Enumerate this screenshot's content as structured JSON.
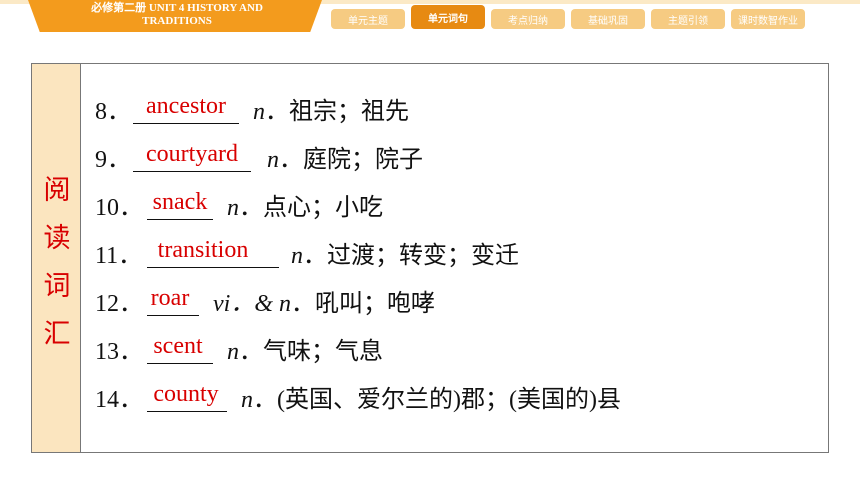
{
  "header": {
    "course_line1": "必修第二册   UNIT 4    HISTORY AND",
    "course_line2": "TRADITIONS",
    "tabs": [
      "单元主题",
      "单元词句",
      "考点归纳",
      "基础巩固",
      "主题引领",
      "课时数智作业"
    ],
    "active_tab": "单元词句"
  },
  "sidebar": {
    "chars": [
      "阅",
      "读",
      "词",
      "汇"
    ]
  },
  "rows": [
    {
      "num": "8．",
      "answer": "ancestor",
      "pos": "n",
      "meaning": "．祖宗；祖先"
    },
    {
      "num": "9．",
      "answer": "courtyard",
      "pos": "n",
      "meaning": "．庭院；院子"
    },
    {
      "num": "10．",
      "answer": "snack",
      "pos": "n",
      "meaning": "．点心；小吃"
    },
    {
      "num": "11．",
      "answer": "transition",
      "pos": "n",
      "meaning": "．过渡；转变；变迁"
    },
    {
      "num": "12．",
      "answer": "roar",
      "pos": "vi．& n",
      "meaning": "．吼叫；咆哮"
    },
    {
      "num": "13．",
      "answer": "scent",
      "pos": "n",
      "meaning": "．气味；气息"
    },
    {
      "num": "14．",
      "answer": "county",
      "pos": "n",
      "meaning": "．(英国、爱尔兰的)郡；(美国的)县"
    }
  ],
  "colors": {
    "accent": "#f39b1d",
    "tab": "#f6cb82",
    "answer": "#d80000",
    "sidebar_bg": "#fbe5bf"
  }
}
